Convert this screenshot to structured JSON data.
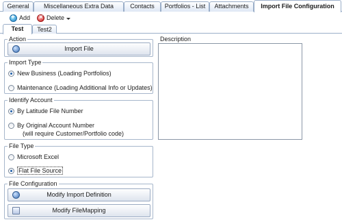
{
  "top_tabs": [
    {
      "label": "General"
    },
    {
      "label": "Miscellaneous Extra Data"
    },
    {
      "label": "Contacts"
    },
    {
      "label": "Portfolios - List"
    },
    {
      "label": "Attachments"
    },
    {
      "label": "Import File Configuration",
      "active": true
    }
  ],
  "toolbar": {
    "add_label": "Add",
    "delete_label": "Delete"
  },
  "sub_tabs": [
    {
      "label": "Test",
      "active": true
    },
    {
      "label": "Test2"
    }
  ],
  "action": {
    "title": "Action",
    "import_button": "Import File"
  },
  "import_type": {
    "title": "Import Type",
    "options": [
      {
        "label": "New Business (Loading Portfolios)",
        "selected": true
      },
      {
        "label": "Maintenance (Loading Additional Info or Updates)",
        "selected": false
      }
    ]
  },
  "identify_account": {
    "title": "Identify Account",
    "options": [
      {
        "label": "By Latitude File Number",
        "selected": true
      },
      {
        "label": "By Original Account Number",
        "note": "(will require Customer/Portfolio code)",
        "selected": false
      }
    ]
  },
  "file_type": {
    "title": "File Type",
    "options": [
      {
        "label": "Microsoft Excel",
        "selected": false
      },
      {
        "label": "Flat File Source",
        "selected": true
      }
    ]
  },
  "file_configuration": {
    "title": "File Configuration",
    "modify_import_button": "Modify Import Definition",
    "modify_mapping_button": "Modify FileMapping"
  },
  "description": {
    "title": "Description",
    "value": ""
  }
}
